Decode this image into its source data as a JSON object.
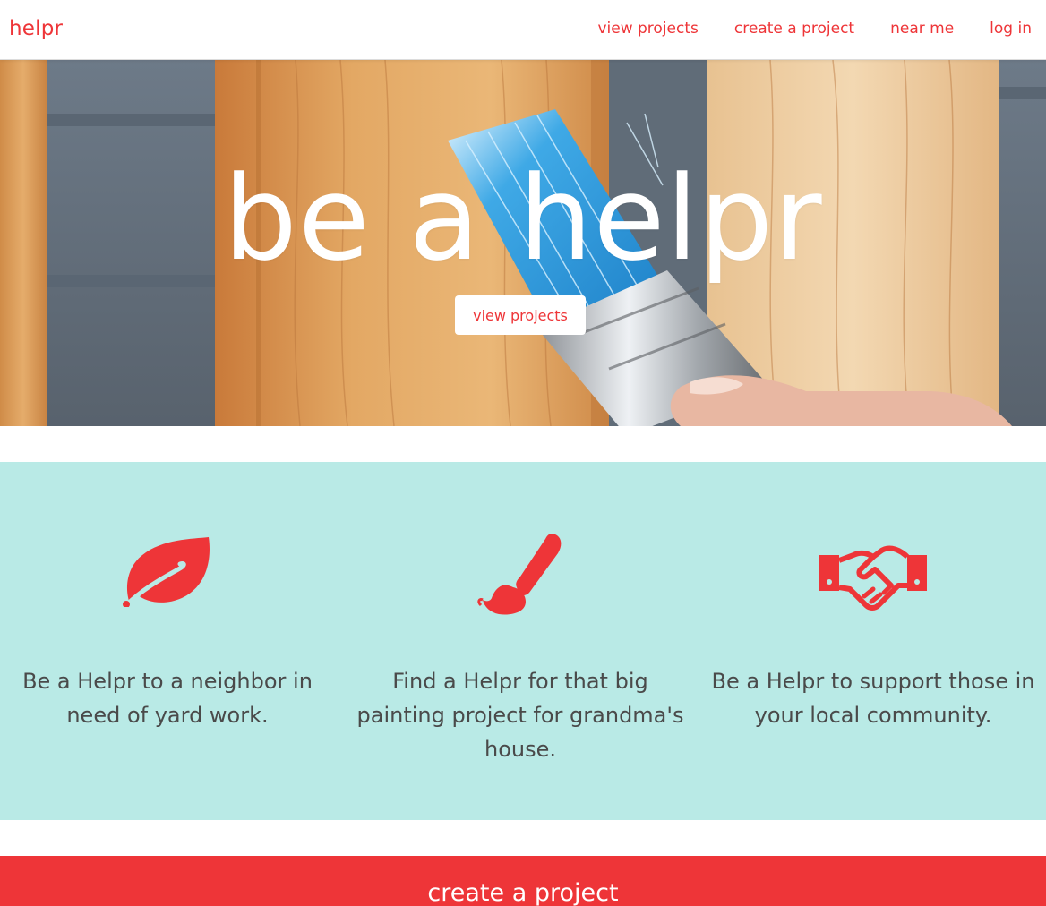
{
  "nav": {
    "brand": "helpr",
    "links": [
      "view projects",
      "create a project",
      "near me",
      "log in"
    ]
  },
  "hero": {
    "title": "be a helpr",
    "button": "view projects"
  },
  "features": [
    {
      "icon": "leaf-icon",
      "text": "Be a Helpr to a neighbor in need of yard work."
    },
    {
      "icon": "paintbrush-icon",
      "text": "Find a Helpr for that big painting project for grandma's house."
    },
    {
      "icon": "handshake-icon",
      "text": "Be a Helpr to support those in your local community."
    }
  ],
  "cta": {
    "title": "create a project"
  },
  "colors": {
    "brand_red": "#ee3538",
    "feature_bg": "#b9eae6",
    "text_dark": "#4a4a4a"
  }
}
